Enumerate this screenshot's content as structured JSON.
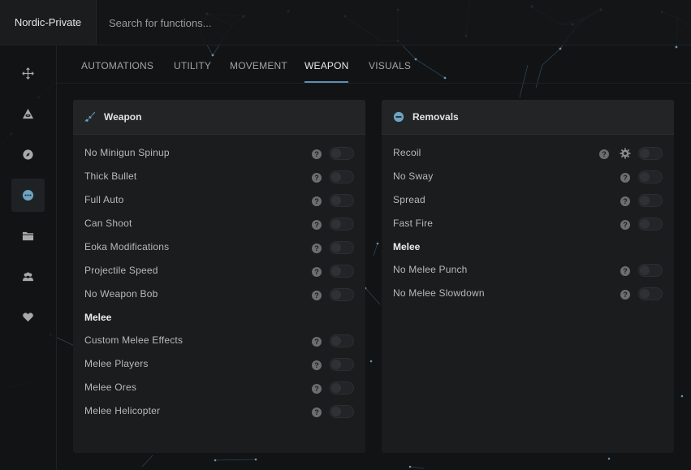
{
  "app": {
    "title": "Nordic-Private"
  },
  "search": {
    "placeholder": "Search for functions..."
  },
  "colors": {
    "accent": "#5b8fb5",
    "background": "#121314",
    "panel": "#1b1c1d"
  },
  "sidebar": {
    "items": [
      {
        "icon": "move-icon",
        "active": false
      },
      {
        "icon": "eye-triangle-icon",
        "active": false
      },
      {
        "icon": "compass-icon",
        "active": false
      },
      {
        "icon": "more-dots-icon",
        "active": true
      },
      {
        "icon": "folder-icon",
        "active": false
      },
      {
        "icon": "users-icon",
        "active": false
      },
      {
        "icon": "heart-icon",
        "active": false
      }
    ]
  },
  "tabs": [
    {
      "label": "AUTOMATIONS",
      "active": false
    },
    {
      "label": "UTILITY",
      "active": false
    },
    {
      "label": "MOVEMENT",
      "active": false
    },
    {
      "label": "WEAPON",
      "active": true
    },
    {
      "label": "VISUALS",
      "active": false
    }
  ],
  "weapon_panel": {
    "title": "Weapon",
    "icon": "rifle-icon",
    "rows": [
      {
        "label": "No Minigun Spinup",
        "enabled": false
      },
      {
        "label": "Thick Bullet",
        "enabled": false
      },
      {
        "label": "Full Auto",
        "enabled": false
      },
      {
        "label": "Can Shoot",
        "enabled": false
      },
      {
        "label": "Eoka Modifications",
        "enabled": false
      },
      {
        "label": "Projectile Speed",
        "enabled": false
      },
      {
        "label": "No Weapon Bob",
        "enabled": false
      }
    ],
    "section": "Melee",
    "melee_rows": [
      {
        "label": "Custom Melee Effects",
        "enabled": false
      },
      {
        "label": "Melee Players",
        "enabled": false
      },
      {
        "label": "Melee Ores",
        "enabled": false
      },
      {
        "label": "Melee Helicopter",
        "enabled": false
      }
    ]
  },
  "removals_panel": {
    "title": "Removals",
    "icon": "minus-circle-icon",
    "rows": [
      {
        "label": "Recoil",
        "enabled": false,
        "settings": true
      },
      {
        "label": "No Sway",
        "enabled": false
      },
      {
        "label": "Spread",
        "enabled": false
      },
      {
        "label": "Fast Fire",
        "enabled": false
      }
    ],
    "section": "Melee",
    "melee_rows": [
      {
        "label": "No Melee Punch",
        "enabled": false
      },
      {
        "label": "No Melee Slowdown",
        "enabled": false
      }
    ]
  },
  "help_glyph": "?"
}
